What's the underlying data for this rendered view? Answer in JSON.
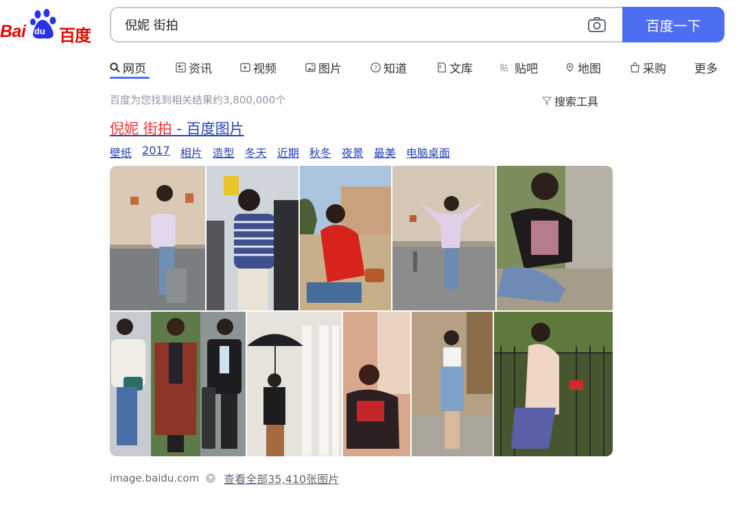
{
  "logo": {
    "bai": "Bai",
    "du": "du",
    "cn": "百度"
  },
  "search": {
    "query": "倪妮 街拍",
    "button_label": "百度一下"
  },
  "tabs": [
    {
      "label": "网页",
      "icon": "search-icon"
    },
    {
      "label": "资讯",
      "icon": "news-icon"
    },
    {
      "label": "视频",
      "icon": "video-icon"
    },
    {
      "label": "图片",
      "icon": "image-icon"
    },
    {
      "label": "知道",
      "icon": "question-icon"
    },
    {
      "label": "文库",
      "icon": "document-icon"
    },
    {
      "label": "贴吧",
      "icon": "tieba-icon"
    },
    {
      "label": "地图",
      "icon": "map-icon"
    },
    {
      "label": "采购",
      "icon": "shopping-icon"
    },
    {
      "label": "更多",
      "icon": ""
    }
  ],
  "results": {
    "count_text": "百度为您找到相关结果约3,800,000个",
    "tools_label": "搜索工具",
    "title_highlight_1": "倪妮",
    "title_highlight_2": "街拍",
    "title_suffix": " - 百度图片",
    "chips": [
      "壁纸",
      "2017",
      "相片",
      "造型",
      "冬天",
      "近期",
      "秋冬",
      "夜景",
      "最美",
      "电脑桌面"
    ],
    "source": "image.baidu.com",
    "view_all": "查看全部35,410张图片"
  },
  "colors": {
    "brand_red": "#e10602",
    "brand_blue": "#4e6ef2",
    "link_blue": "#2440b3",
    "highlight_red": "#f73131"
  }
}
